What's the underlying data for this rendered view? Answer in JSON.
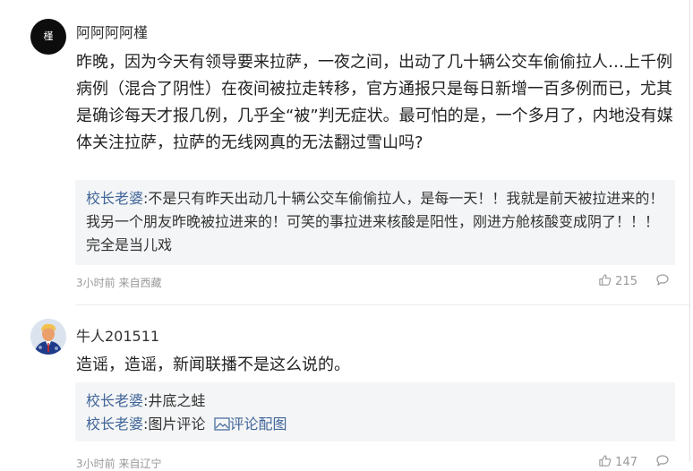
{
  "comments": [
    {
      "avatar_glyph": "槿",
      "username": "阿阿阿阿槿",
      "body": "昨晚，因为今天有领导要来拉萨，一夜之间，出动了几十辆公交车偷偷拉人…上千例病例（混合了阴性）在夜间被拉走转移，官方通报只是每日新增一百多例而已，尤其是确诊每天才报几例，几乎全“被”判无症状。最可怕的是，一个多月了，内地没有媒体关注拉萨，拉萨的无线网真的无法翻过雪山吗?",
      "replies": [
        {
          "user": "校长老婆",
          "text": "不是只有昨天出动几十辆公交车偷偷拉人，是每一天！！我就是前天被拉进来的！我另一个朋友昨晚被拉进来的！可笑的事拉进来核酸是阳性，刚进方舱核酸变成阴了！！！完全是当儿戏"
        }
      ],
      "meta": "3小时前 来自西藏",
      "likes": "215"
    },
    {
      "username": "牛人201511",
      "body": "造谣，造谣，新闻联播不是这么说的。",
      "replies": [
        {
          "user": "校长老婆",
          "text": "井底之蛙"
        },
        {
          "user": "校长老婆",
          "text": "图片评论",
          "link": "评论配图"
        }
      ],
      "meta": "3小时前 来自辽宁",
      "likes": "147"
    }
  ],
  "colors": {
    "username_link": "#406599",
    "meta_gray": "#999999",
    "reply_bg": "#f4f5f6"
  },
  "icons": [
    "thumbs-up-icon",
    "reply-bubble-icon",
    "image-icon"
  ]
}
